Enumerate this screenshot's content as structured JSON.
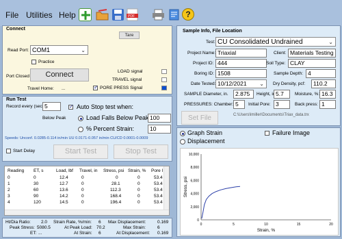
{
  "menu": [
    "File",
    "Utilities",
    "Help"
  ],
  "toolbar_icons": [
    "new-document-icon",
    "open-folder-icon",
    "save-icon",
    "pdf-icon",
    "print-icon",
    "stamp-icon",
    "help-icon"
  ],
  "connect": {
    "title": "Connect",
    "tare_label": "Tare",
    "read_port_label": "Read Port:",
    "read_port_value": "COM1",
    "practice_label": "Practice",
    "port_status": "Port Closed",
    "connect_button": "Connect",
    "travel_home_label": "Travel Home:",
    "travel_home_value": "...",
    "signals": [
      {
        "label": "LOAD signal",
        "on": false
      },
      {
        "label": "TRAVEL signal",
        "on": false
      },
      {
        "label": "PORE PRESS Signal",
        "on": true
      }
    ]
  },
  "sample_info": {
    "title": "Sample Info, File Location",
    "test_label": "Test:",
    "test_value": "CU Consolidated Undrained",
    "project_name_label": "Project Name:",
    "project_name_value": "Triaxial",
    "client_label": "Client:",
    "client_value": "Materials Testing",
    "project_id_label": "Project ID:",
    "project_id_value": "444",
    "soil_type_label": "Soil Type:",
    "soil_type_value": "CLAY",
    "boring_id_label": "Boring ID:",
    "boring_id_value": "1508",
    "sample_depth_label": "Sample Depth:",
    "sample_depth_value": "4",
    "date_tested_label": "Date Tested:",
    "date_tested_value": "10/12/2021",
    "dry_density_label": "Dry Density, pcf:",
    "dry_density_value": "110.2",
    "diameter_label": "SAMPLE Diameter, in.",
    "diameter_value": "2.875",
    "height_label": "Height, in.",
    "height_value": "5.7",
    "moisture_label": "Moisture, %:",
    "moisture_value": "16.3",
    "chamber_label": "PRESSURES: Chamber:",
    "chamber_value": "5",
    "initial_pore_label": "Initial Pore:",
    "initial_pore_value": "3",
    "back_press_label": "Back press:",
    "back_press_value": "1",
    "set_file_button": "Set File",
    "file_path": "C:\\Users\\lmiller\\Documents\\Triax_data.trx"
  },
  "run_test": {
    "title": "Run Test",
    "record_every_label": "Record every (sec):",
    "record_every_value": "5",
    "auto_stop_label": "Auto Stop test when:",
    "below_peak_label": "Below Peak",
    "load_falls_label": "Load Falls Below Peak:",
    "load_falls_value": "100",
    "percent_strain_label": "% Percent Strain:",
    "percent_strain_value": "10",
    "speeds_text": "Speeds: Unconf. 0.0285-0.114 in/min UU 0.0171-0.057 in/min CU/CD 0.0001-0.0009",
    "start_delay_label": "Start Delay",
    "start_button": "Start Test",
    "stop_button": "Stop Test"
  },
  "table": {
    "headers": [
      "Reading",
      "ET, s",
      "Load, lbf",
      "Travel, in",
      "Stress, psi",
      "Strain, %",
      "Pore I"
    ],
    "rows": [
      [
        "0",
        "0",
        "12.4",
        "0",
        "0",
        "0",
        "53.4"
      ],
      [
        "1",
        "30",
        "12.7",
        "0",
        "28.1",
        "0",
        "53.4"
      ],
      [
        "2",
        "60",
        "13.6",
        "0",
        "112.3",
        "0",
        "53.4"
      ],
      [
        "3",
        "90",
        "14.2",
        "0",
        "168.4",
        "0",
        "53.4"
      ],
      [
        "4",
        "120",
        "14.5",
        "0",
        "196.4",
        "0",
        "53.4"
      ]
    ]
  },
  "stats": {
    "ht_dia_label": "Ht/Dia Ratio:",
    "ht_dia_value": "2.0",
    "strain_rate_label": "Strain Rate, %/min:",
    "strain_rate_value": "6",
    "max_disp_label": "Max Displacement:",
    "max_disp_value": "0.169",
    "peak_stress_label": "Peak Stress:",
    "peak_stress_value": "5080.5",
    "at_peak_load_label": "At Peak Load:",
    "at_peak_load_value": "70.2",
    "max_strain_label": "Max Strain:",
    "max_strain_value": "6",
    "et_label": "ET:",
    "et_value": "...",
    "at_strain_label": "At Strain:",
    "at_strain_value": "6",
    "at_displacement_label": "At Displacement:",
    "at_displacement_value": "0.169"
  },
  "graph": {
    "graph_strain_label": "Graph Strain",
    "displacement_label": "Displacement",
    "failure_image_label": "Failure Image"
  },
  "chart_data": {
    "type": "line",
    "xlabel": "Strain, %",
    "ylabel": "Stress, psi",
    "xlim": [
      0,
      20
    ],
    "ylim": [
      0,
      10000
    ],
    "xticks": [
      0,
      5,
      10,
      15,
      20
    ],
    "yticks": [
      "0",
      "2,000",
      "4,000",
      "6,000",
      "8,000",
      "10,000"
    ],
    "x": [
      0.1,
      0.3,
      0.5,
      0.8,
      1.2,
      1.7,
      2.3,
      3.0,
      3.8,
      4.6,
      5.4,
      6.0
    ],
    "y": [
      200,
      1200,
      2300,
      3100,
      3600,
      4000,
      4300,
      4550,
      4750,
      4900,
      5020,
      5080
    ],
    "grid": false,
    "color": "#2b3fa8"
  }
}
